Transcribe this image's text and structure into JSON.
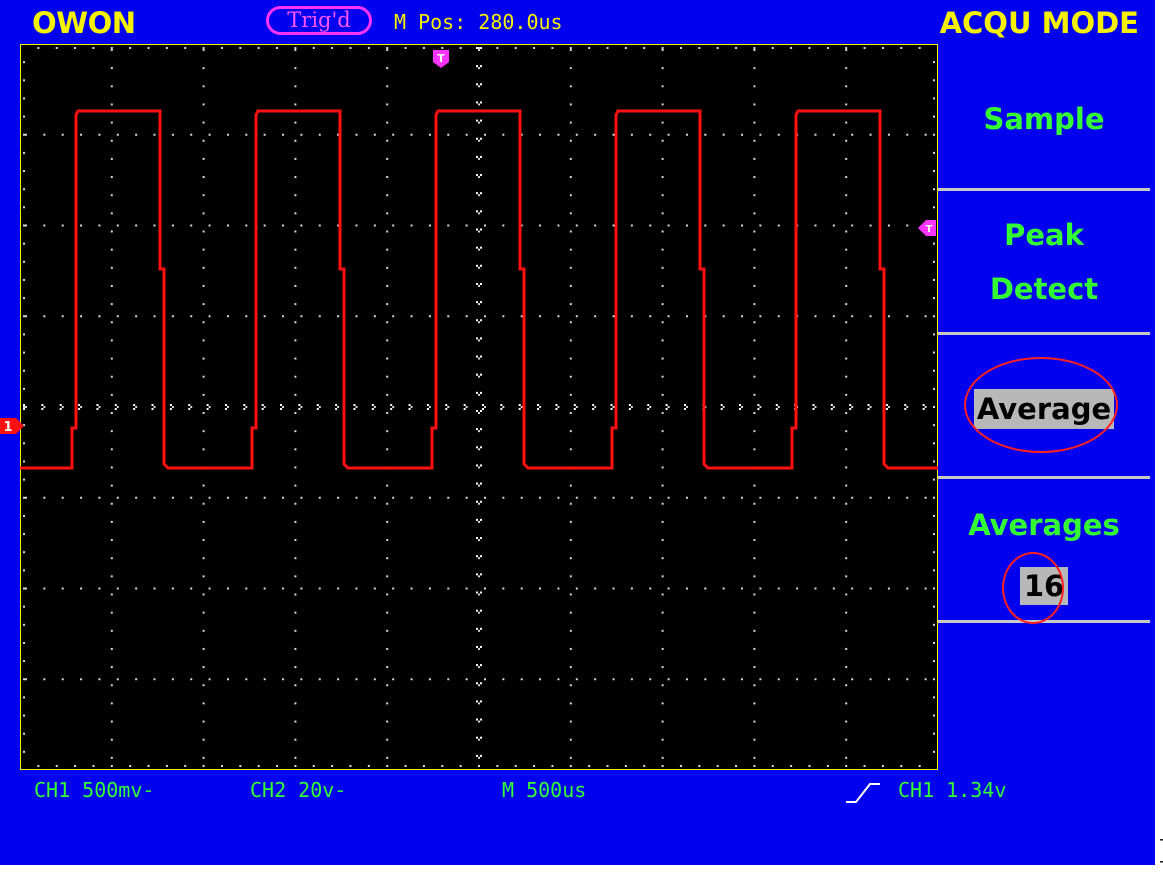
{
  "header": {
    "brand": "OWON",
    "trigger_status": "Trig'd",
    "horizontal_position": "M Pos: 280.0us",
    "menu_title": "ACQU MODE"
  },
  "menu": {
    "items": [
      {
        "label_lines": [
          "Sample"
        ],
        "selected": false
      },
      {
        "label_lines": [
          "Peak",
          "Detect"
        ],
        "selected": false
      },
      {
        "label_lines": [
          "Average"
        ],
        "selected": true
      },
      {
        "label_lines": [
          "Averages"
        ],
        "value": "16"
      }
    ]
  },
  "markers": {
    "trigger_time": "T",
    "trigger_level": "T",
    "channel1": "1"
  },
  "status_bar": {
    "ch1_scale": "CH1 500mv-",
    "ch2_scale": "CH2 20v-",
    "timebase": "M 500us",
    "trigger_info": "CH1 1.34v"
  },
  "colors": {
    "screen_background": "#0000ee",
    "grid_background": "#000000",
    "waveform": "#ff1010",
    "grid_dots": "#d8d8d8",
    "text_yellow": "#f4f000",
    "text_green": "#33ff33",
    "marker_magenta": "#ff33ff",
    "highlight_circle": "#ff2020"
  },
  "icons": {
    "trigger_edge": "rising-edge-icon"
  },
  "trailing_glyph": "]"
}
